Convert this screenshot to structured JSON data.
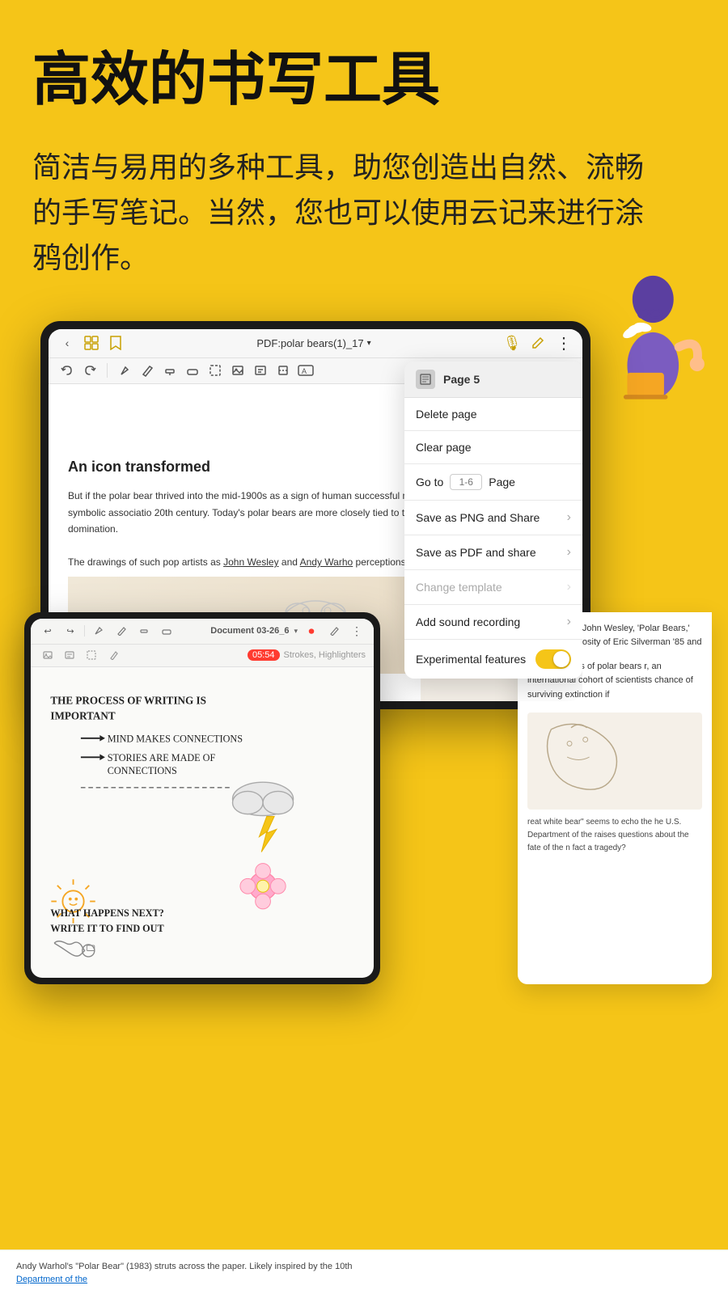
{
  "hero": {
    "title": "高效的书写工具",
    "description": "简洁与易用的多种工具，助您创造出自然、流畅的手写笔记。当然，您也可以使用云记来进行涂鸦创作。"
  },
  "ipad_main": {
    "toolbar": {
      "back_icon": "‹",
      "title": "PDF:polar bears(1)_17",
      "title_arrow": "∨",
      "mic_icon": "🎙",
      "pencil_icon": "✏",
      "more_icon": "⋮"
    },
    "secondary_toolbar": {
      "undo": "↩",
      "redo": "↪"
    }
  },
  "dropdown": {
    "header": "Page 5",
    "items": [
      {
        "label": "Delete page",
        "type": "action",
        "disabled": false
      },
      {
        "label": "Clear page",
        "type": "action",
        "disabled": false
      },
      {
        "label": "Go to",
        "type": "goto",
        "placeholder": "1-6",
        "suffix": "Page",
        "disabled": false
      },
      {
        "label": "Save as PNG and Share",
        "type": "arrow",
        "disabled": false
      },
      {
        "label": "Save as PDF and share",
        "type": "arrow",
        "disabled": false
      },
      {
        "label": "Change template",
        "type": "arrow",
        "disabled": true
      },
      {
        "label": "Add sound recording",
        "type": "arrow",
        "disabled": false
      },
      {
        "label": "Experimental features",
        "type": "toggle",
        "disabled": false,
        "toggled": true
      }
    ]
  },
  "doc": {
    "title": "An icon transformed",
    "body1": "But if the polar bear thrived into the mid-1900s as a sign of human successful mastery of antagonistic forces, this symbolic associatio 20th century. Today's polar bears are more closely tied to the dem belief in conquest and domination.",
    "body2": "The drawings of such pop artists as John Wesley and Andy Warho perceptions."
  },
  "second_device": {
    "toolbar": {
      "title": "Document 03-26_6",
      "timer": "05:54",
      "more_icon": "⋮",
      "record_icon": "⏺"
    },
    "strokes_label": "Strokes, Highlighters",
    "handwriting": [
      "The process of writing is",
      "important",
      "→ mind makes connections",
      "→ stories are made of",
      "  connections",
      "- - - - - -",
      "What happens next?",
      "Write it to find out"
    ]
  },
  "right_content": {
    "body1": "omber mood. John Wesley, 'Polar Bears,' ugh the generosity of Eric Silverman '85 and",
    "body2": "rtwined bodies of polar bears r, an international cohort of scientists chance of surviving extinction if",
    "body3": "reat white bear\" seems to echo the he U.S. Department of the raises questions about the fate of the n fact a tragedy?",
    "caption": "Department of the"
  },
  "bottom_text": "Andy Warhol's \"Polar Bear\" (1983) struts across the paper. Likely inspired by the 10th"
}
